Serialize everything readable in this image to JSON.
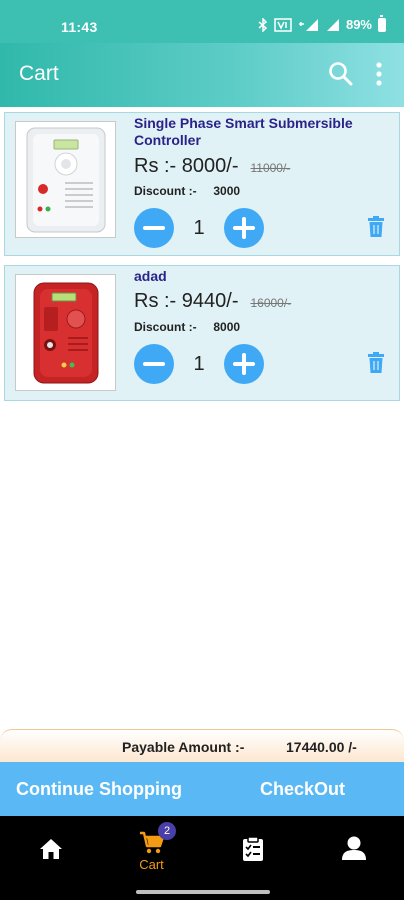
{
  "status_bar": {
    "time": "11:43",
    "battery": "89%"
  },
  "app_bar": {
    "title": "Cart",
    "search_icon": "search-icon",
    "menu_icon": "more-vert-icon"
  },
  "cart": {
    "items": [
      {
        "name": "Single Phase Smart Submersible Controller",
        "price": "Rs :- 8000/-",
        "mrp": "11000/-",
        "discount_label": "Discount :-",
        "discount_value": "3000",
        "quantity": "1",
        "image_icon": "controller-device-white"
      },
      {
        "name": "adad",
        "price": "Rs :- 9440/-",
        "mrp": "16000/-",
        "discount_label": "Discount :-",
        "discount_value": "8000",
        "quantity": "1",
        "image_icon": "controller-device-red"
      }
    ]
  },
  "payable": {
    "label": "Payable Amount :-",
    "value": "17440.00 /-"
  },
  "actions": {
    "continue_label": "Continue Shopping",
    "checkout_label": "CheckOut"
  },
  "bottom_nav": {
    "cart_label": "Cart",
    "cart_badge": "2",
    "accent": "#f39c12"
  },
  "colors": {
    "primary": "#3dbfb2",
    "action_blue": "#5ab8f5",
    "button_blue": "#3fa9f5",
    "title_purple": "#2a2389"
  }
}
